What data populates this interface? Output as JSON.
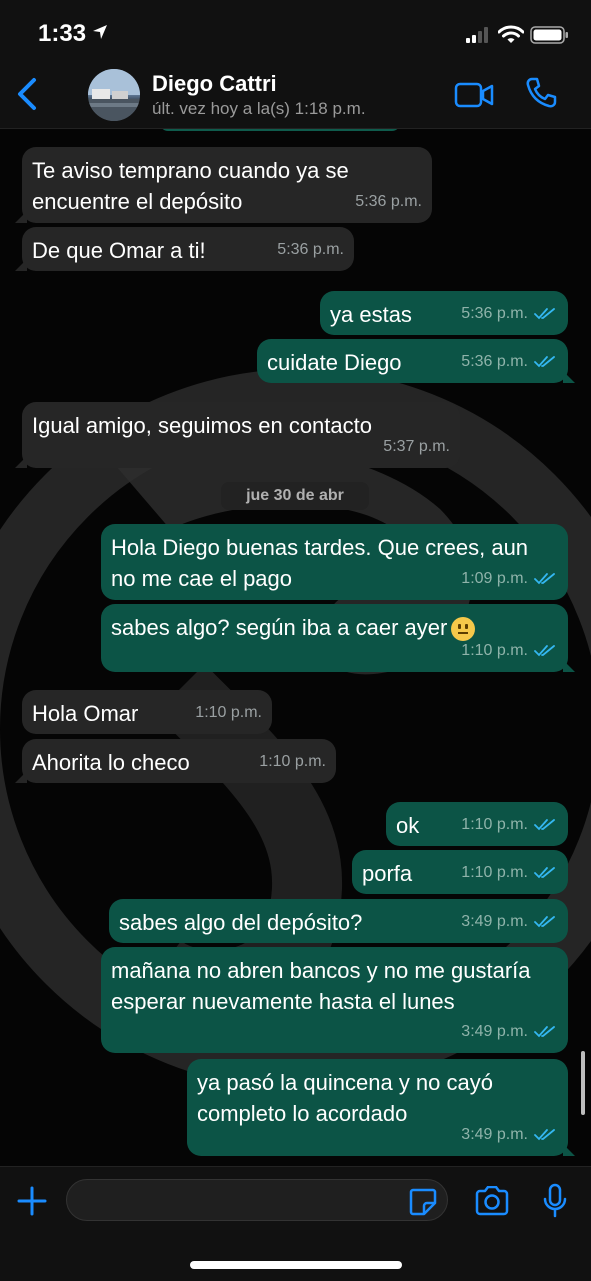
{
  "status_bar": {
    "time": "1:33",
    "location_icon": "location-arrow-icon",
    "signal_icon": "cellular-signal-icon",
    "wifi_icon": "wifi-icon",
    "battery_icon": "battery-icon"
  },
  "header": {
    "back_icon": "chevron-left-icon",
    "contact_name": "Diego Cattri",
    "contact_status": "últ. vez hoy a la(s) 1:18 p.m.",
    "video_icon": "video-camera-icon",
    "call_icon": "phone-icon"
  },
  "colors": {
    "accent": "#1a8cff",
    "incoming_bubble": "#262626",
    "outgoing_bubble": "#0c5446",
    "read_check": "#34b7f1"
  },
  "messages": [
    {
      "dir": "in",
      "text": "Te aviso temprano cuando ya se encuentre el depósito",
      "time": "5:36 p.m."
    },
    {
      "dir": "in",
      "text": "De que Omar  a ti!",
      "time": "5:36 p.m."
    },
    {
      "dir": "out",
      "text": "ya estas",
      "time": "5:36 p.m.",
      "status": "read"
    },
    {
      "dir": "out",
      "text": "cuidate Diego",
      "time": "5:36 p.m.",
      "status": "read"
    },
    {
      "dir": "in",
      "text": "Igual amigo, seguimos en contacto",
      "time": "5:37 p.m."
    },
    {
      "dir": "out",
      "text": "Hola Diego buenas tardes. Que crees, aun no me cae el pago",
      "time": "1:09 p.m.",
      "status": "read"
    },
    {
      "dir": "out",
      "text": "sabes algo? según iba a caer ayer",
      "emoji": "neutral-face-emoji",
      "time": "1:10 p.m.",
      "status": "read"
    },
    {
      "dir": "in",
      "text": "Hola Omar",
      "time": "1:10 p.m."
    },
    {
      "dir": "in",
      "text": "Ahorita lo checo",
      "time": "1:10 p.m."
    },
    {
      "dir": "out",
      "text": "ok",
      "time": "1:10 p.m.",
      "status": "read"
    },
    {
      "dir": "out",
      "text": "porfa",
      "time": "1:10 p.m.",
      "status": "read"
    },
    {
      "dir": "out",
      "text": "sabes algo del depósito?",
      "time": "3:49 p.m.",
      "status": "read"
    },
    {
      "dir": "out",
      "text": "mañana no abren bancos y no me gustaría esperar nuevamente hasta el lunes",
      "time": "3:49 p.m.",
      "status": "read"
    },
    {
      "dir": "out",
      "text": "ya pasó la quincena y no cayó completo lo acordado",
      "time": "3:49 p.m.",
      "status": "read"
    }
  ],
  "date_divider": "jue 30 de abr",
  "input_bar": {
    "placeholder": "",
    "plus_icon": "plus-icon",
    "sticker_icon": "sticker-icon",
    "camera_icon": "camera-icon",
    "mic_icon": "microphone-icon"
  }
}
